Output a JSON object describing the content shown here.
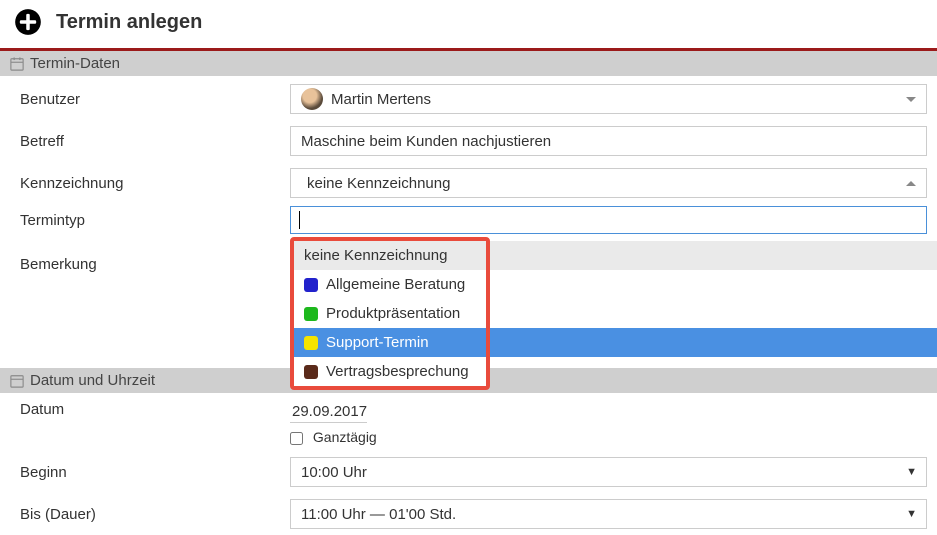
{
  "header": {
    "title": "Termin anlegen"
  },
  "sec1": {
    "title": "Termin-Daten"
  },
  "benutzer": {
    "label": "Benutzer",
    "value": "Martin Mertens"
  },
  "betreff": {
    "label": "Betreff",
    "value": "Maschine beim Kunden nachjustieren"
  },
  "kennzeichnung": {
    "label": "Kennzeichnung",
    "value": "keine Kennzeichnung",
    "search": "",
    "opt0": "keine Kennzeichnung",
    "opt1": "Allgemeine Beratung",
    "opt2": "Produktpräsentation",
    "opt3": "Support-Termin",
    "opt4": "Vertragsbesprechung"
  },
  "termintyp": {
    "label": "Termintyp"
  },
  "bemerkung": {
    "label": "Bemerkung"
  },
  "sec2": {
    "title": "Datum und Uhrzeit"
  },
  "datum": {
    "label": "Datum",
    "value": "29.09.2017"
  },
  "ganz": {
    "label": "Ganztägig"
  },
  "beginn": {
    "label": "Beginn",
    "value": "10:00 Uhr"
  },
  "bis": {
    "label": "Bis (Dauer)",
    "value": "11:00 Uhr — 01'00 Std."
  }
}
